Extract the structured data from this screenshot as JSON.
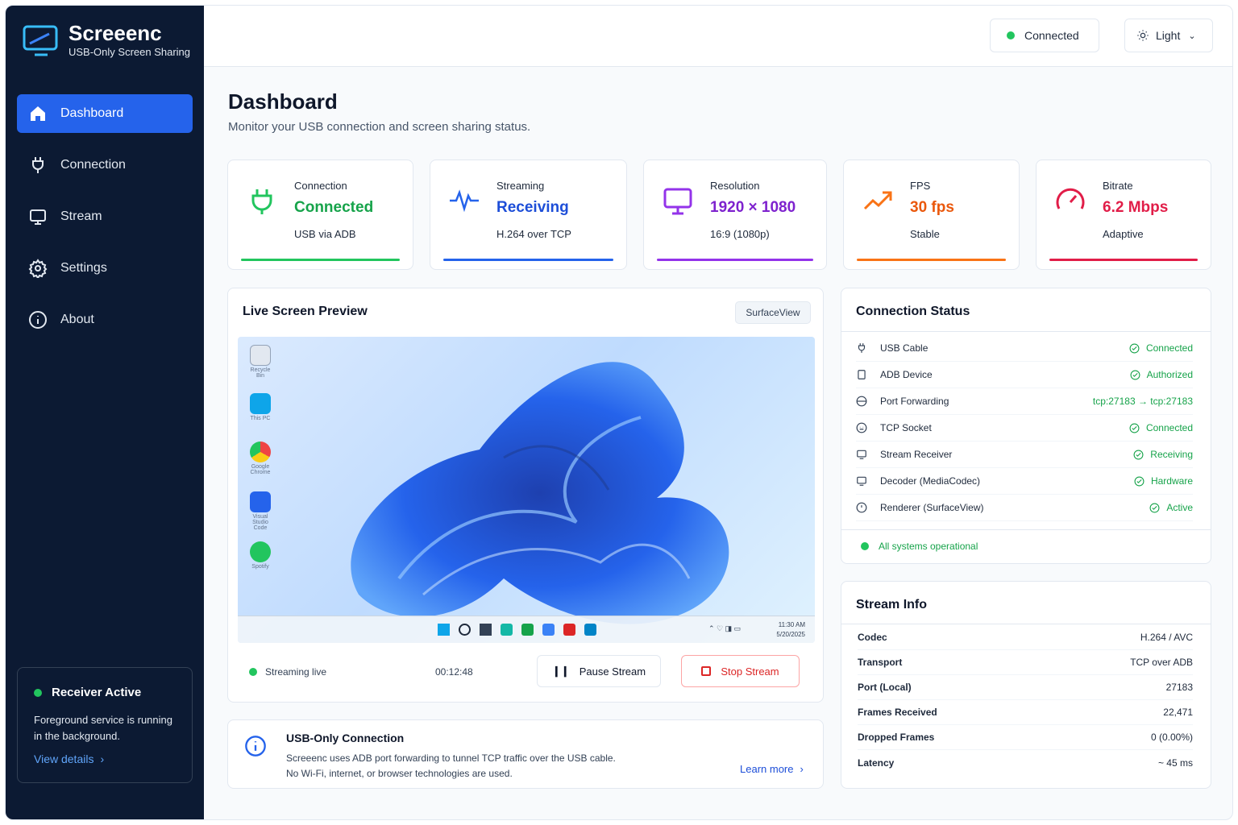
{
  "brand": {
    "name": "Screeenc",
    "subtitle": "USB-Only Screen Sharing"
  },
  "nav": [
    {
      "label": "Dashboard"
    },
    {
      "label": "Connection"
    },
    {
      "label": "Stream"
    },
    {
      "label": "Settings"
    },
    {
      "label": "About"
    }
  ],
  "receiver": {
    "title": "Receiver Active",
    "text": "Foreground service is running in the background.",
    "link": "View details"
  },
  "topbar": {
    "status": "Connected",
    "theme": "Light"
  },
  "page": {
    "title": "Dashboard",
    "subtitle": "Monitor your USB connection and screen sharing status."
  },
  "stats": [
    {
      "label": "Connection",
      "value": "Connected",
      "sub": "USB via ADB",
      "color": "#16a34a",
      "bar": "#22c55e"
    },
    {
      "label": "Streaming",
      "value": "Receiving",
      "sub": "H.264 over TCP",
      "color": "#1d4ed8",
      "bar": "#2563eb"
    },
    {
      "label": "Resolution",
      "value": "1920 × 1080",
      "sub": "16:9 (1080p)",
      "color": "#7e22ce",
      "bar": "#9333ea"
    },
    {
      "label": "FPS",
      "value": "30 fps",
      "sub": "Stable",
      "color": "#ea580c",
      "bar": "#f97316"
    },
    {
      "label": "Bitrate",
      "value": "6.2 Mbps",
      "sub": "Adaptive",
      "color": "#e11d48",
      "bar": "#e11d48"
    }
  ],
  "preview": {
    "title": "Live Screen Preview",
    "badge": "SurfaceView",
    "status": "Streaming live",
    "time": "00:12:48",
    "pause": "Pause Stream",
    "stop": "Stop Stream",
    "desktop": {
      "icons": [
        "Recycle Bin",
        "This PC",
        "Google Chrome",
        "Visual Studio Code",
        "Spotify"
      ],
      "clock": "11:30 AM",
      "date": "5/20/2025"
    }
  },
  "usb": {
    "title": "USB-Only Connection",
    "line1": "Screeenc uses ADB port forwarding to tunnel TCP traffic over the USB cable.",
    "line2": "No Wi-Fi, internet, or browser technologies are used.",
    "link": "Learn more"
  },
  "connection": {
    "title": "Connection Status",
    "rows": [
      {
        "name": "USB Cable",
        "value": "Connected"
      },
      {
        "name": "ADB Device",
        "value": "Authorized"
      },
      {
        "name": "Port Forwarding",
        "value": "tcp:27183 → tcp:27183"
      },
      {
        "name": "TCP Socket",
        "value": "Connected"
      },
      {
        "name": "Stream Receiver",
        "value": "Receiving"
      },
      {
        "name": "Decoder (MediaCodec)",
        "value": "Hardware"
      },
      {
        "name": "Renderer (SurfaceView)",
        "value": "Active"
      }
    ],
    "footer": "All systems operational"
  },
  "stream_info": {
    "title": "Stream Info",
    "rows": [
      {
        "k": "Codec",
        "v": "H.264 / AVC"
      },
      {
        "k": "Transport",
        "v": "TCP over ADB"
      },
      {
        "k": "Port (Local)",
        "v": "27183"
      },
      {
        "k": "Frames Received",
        "v": "22,471"
      },
      {
        "k": "Dropped Frames",
        "v": "0 (0.00%)"
      },
      {
        "k": "Latency",
        "v": "~ 45 ms"
      }
    ]
  },
  "colors": {
    "sidebar": "#0c1a33",
    "accent": "#2563eb",
    "success": "#22c55e"
  }
}
